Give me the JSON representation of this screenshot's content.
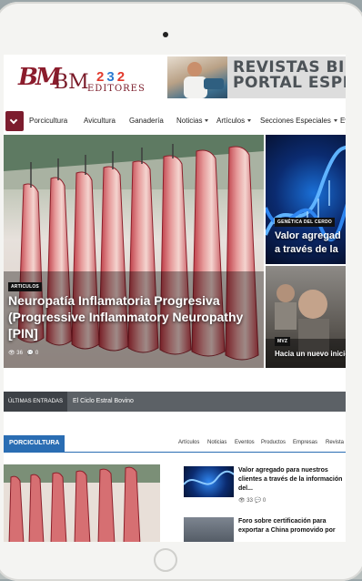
{
  "logo": {
    "mark": "BM",
    "text": "BM",
    "subtext": "EDITORES",
    "dots": "2 3 2"
  },
  "banner": {
    "line1": "REVISTAS BIME",
    "line2": "PORTAL ESPEC"
  },
  "nav": {
    "items": [
      "Porcicultura",
      "Avicultura",
      "Ganadería",
      "Noticias",
      "Artículos",
      "Secciones Especiales",
      "Ev"
    ]
  },
  "hero": {
    "tag": "ARTICULOS",
    "title": "Neuropatía Inflamatoria Progresiva (Progressive Inflammatory Neuropathy [PIN]",
    "views": "36",
    "comments": "0"
  },
  "side_features": [
    {
      "tag": "GENÉTICA DEL CERDO",
      "title_line1": "Valor agregad",
      "title_line2": "a través de la"
    },
    {
      "tag": "MVZ",
      "title": "Hacia un nuevo inicio"
    }
  ],
  "ticker": {
    "label": "ÚLTIMAS ENTRADAS",
    "text": "El Ciclo Estral Bovino"
  },
  "section": {
    "label": "PORCICULTURA",
    "tabs": [
      "Artículos",
      "Noticias",
      "Eventos",
      "Productos",
      "Empresas",
      "Revista"
    ]
  },
  "list_items": [
    {
      "title": "Valor agregado para nuestros clientes a través de la información del...",
      "views": "33",
      "comments": "0"
    },
    {
      "title": "Foro sobre certificación para exportar a China promovido por"
    }
  ],
  "colors": {
    "brand": "#7c1d2e",
    "section": "#2a6db3",
    "ticker": "#5c6166"
  }
}
